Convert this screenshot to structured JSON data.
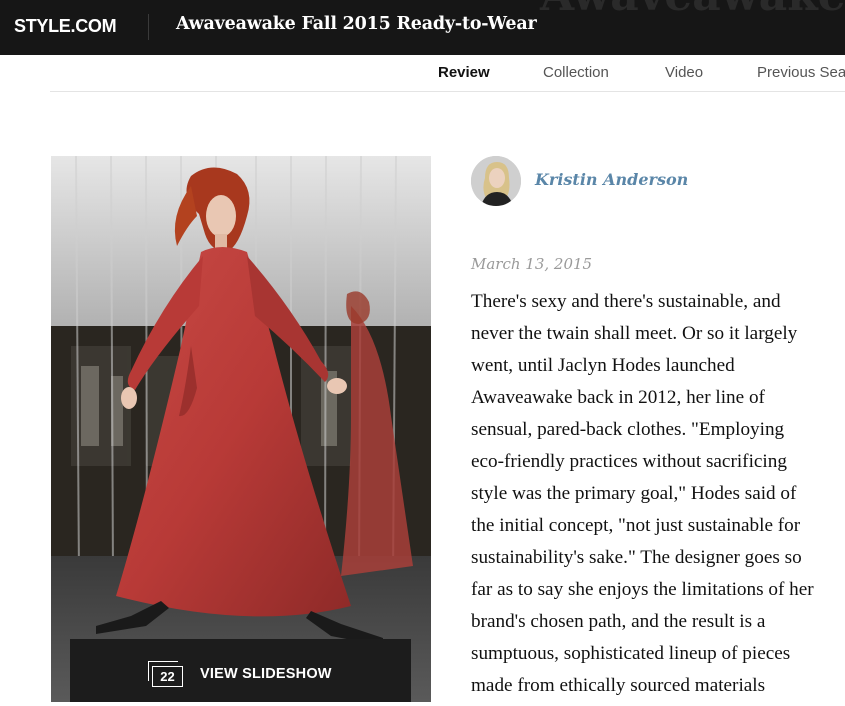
{
  "header": {
    "logo": "STYLE.COM",
    "title": "Awaveawake Fall 2015 Ready-to-Wear",
    "background_title": "Awaveawake"
  },
  "tabs": [
    {
      "label": "Review",
      "active": true
    },
    {
      "label": "Collection",
      "active": false
    },
    {
      "label": "Video",
      "active": false
    },
    {
      "label": "Previous Sea",
      "active": false
    }
  ],
  "slideshow": {
    "count": "22",
    "label": "VIEW SLIDESHOW"
  },
  "review": {
    "author": "Kristin Anderson",
    "date": "March 13, 2015",
    "lines": [
      "There's sexy and there's sustainable, and",
      "never the twain shall meet. Or so it largely",
      "went, until Jaclyn Hodes launched",
      "Awaveawake back in 2012, her line of",
      "sensual, pared-back clothes. \"Employing",
      "eco-friendly practices without sacrificing",
      "style was the primary goal,\" Hodes said of",
      "the initial concept, \"not just sustainable for",
      "sustainability's sake.\" The designer goes so",
      "far as to say she enjoys the limitations of her",
      "brand's chosen path, and the result is a",
      "sumptuous, sophisticated lineup of pieces",
      "made from ethically sourced materials"
    ]
  },
  "colors": {
    "topbar": "#161616",
    "author_link": "#5a86a8",
    "dress_red": "#b83a37"
  }
}
